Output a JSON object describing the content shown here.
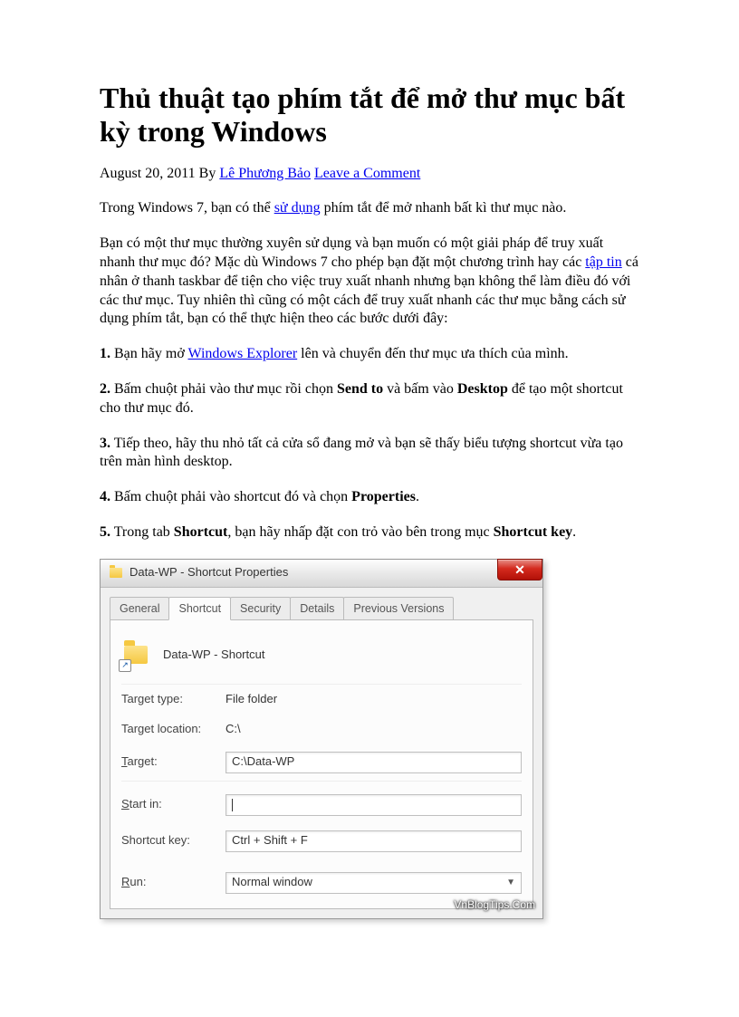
{
  "title": "Thủ thuật tạo phím tắt để mở thư mục bất kỳ trong Windows",
  "meta": {
    "date": "August 20, 2011",
    "by": "By",
    "author": "Lê Phương Bảo",
    "comment_link": "Leave a Comment"
  },
  "intro": {
    "prefix": "Trong Windows 7, bạn có thể ",
    "link": "sử dụng",
    "suffix": " phím tắt để mở nhanh bất kì thư mục nào."
  },
  "para2": {
    "part1": "Bạn có một thư mục thường xuyên sử dụng và bạn muốn có một giải pháp để truy xuất nhanh thư mục đó? Mặc dù Windows 7 cho phép bạn đặt một chương trình hay các ",
    "link": "tập tin",
    "part2": " cá nhân ở thanh taskbar để tiện cho việc truy xuất nhanh nhưng bạn không thể làm điều đó với các thư mục. Tuy nhiên thì cũng có một cách để truy xuất nhanh các thư mục bằng cách sử dụng phím tắt, bạn có thể thực hiện theo các bước dưới đây:"
  },
  "steps": {
    "s1": {
      "num": "1.",
      "pre": " Bạn hãy mở ",
      "link": "Windows Explorer",
      "post": " lên và chuyển đến thư mục ưa thích của mình."
    },
    "s2": {
      "num": "2.",
      "pre": " Bấm chuột phải vào thư mục rồi chọn ",
      "b1": "Send to",
      "mid": " và bấm vào ",
      "b2": "Desktop",
      "post": " để tạo một shortcut cho thư mục đó."
    },
    "s3": {
      "num": "3.",
      "text": " Tiếp theo, hãy thu nhỏ tất cả cửa sổ đang mở và bạn sẽ thấy biểu tượng shortcut vừa tạo trên màn hình desktop."
    },
    "s4": {
      "num": "4.",
      "pre": " Bấm chuột phải vào shortcut đó và chọn ",
      "b1": "Properties",
      "post": "."
    },
    "s5": {
      "num": "5.",
      "pre": " Trong tab ",
      "b1": "Shortcut",
      "mid": ", bạn hãy nhấp đặt con trỏ vào bên trong mục ",
      "b2": "Shortcut key",
      "post": "."
    }
  },
  "dialog": {
    "title": "Data-WP - Shortcut Properties",
    "close": "✕",
    "tabs": {
      "general": "General",
      "shortcut": "Shortcut",
      "security": "Security",
      "details": "Details",
      "previous": "Previous Versions"
    },
    "shortcut_name": "Data-WP - Shortcut",
    "labels": {
      "target_type": "Target type:",
      "target_location": "Target location:",
      "target_u": "T",
      "target_rest": "arget:",
      "startin_u": "S",
      "startin_rest": "tart in:",
      "shortcutkey": "Shortcut key:",
      "run_u": "R",
      "run_rest": "un:"
    },
    "values": {
      "target_type": "File folder",
      "target_location": "C:\\",
      "target": "C:\\Data-WP",
      "start_in": "",
      "shortcut_key": "Ctrl + Shift + F",
      "run": "Normal window"
    },
    "watermark": "VnBlogTips.Com"
  }
}
